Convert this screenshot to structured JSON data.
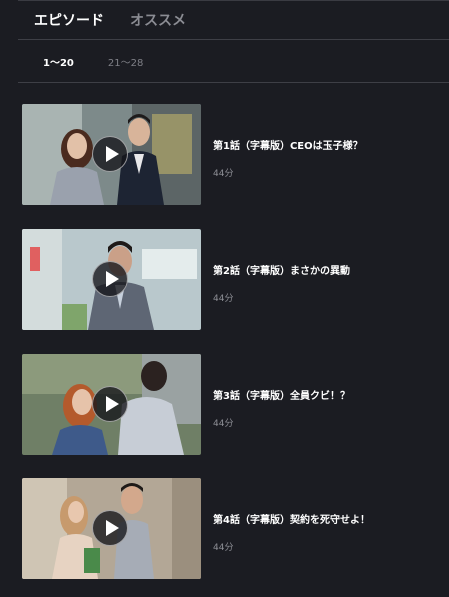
{
  "tabs": [
    {
      "label": "エピソード",
      "active": true
    },
    {
      "label": "オススメ",
      "active": false
    }
  ],
  "ranges": [
    {
      "label": "1〜20",
      "active": true
    },
    {
      "label": "21〜28",
      "active": false
    }
  ],
  "episodes": [
    {
      "title": "第1話（字幕版）CEOは玉子様？",
      "duration": "44分"
    },
    {
      "title": "第2話（字幕版）まさかの異動",
      "duration": "44分"
    },
    {
      "title": "第3話（字幕版）全員クビ！？",
      "duration": "44分"
    },
    {
      "title": "第4話（字幕版）契約を死守せよ！",
      "duration": "44分"
    }
  ],
  "icons": {
    "play": "play-icon"
  },
  "colors": {
    "background": "#1b1c22",
    "divider": "#3e3f46",
    "text_primary": "#ffffff",
    "text_muted": "#8b8c93"
  }
}
